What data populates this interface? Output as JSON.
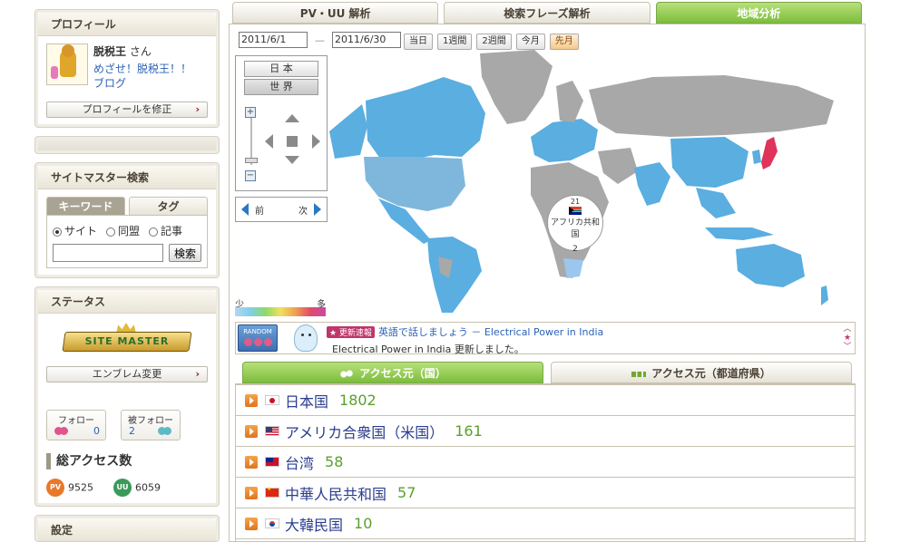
{
  "sidebar": {
    "profile": {
      "title": "プロフィール",
      "name": "脱税王",
      "suffix": " さん",
      "blog_line1": "めざせ！脱税王！！",
      "blog_line2": "ブログ",
      "edit_label": "プロフィールを修正"
    },
    "search": {
      "title": "サイトマスター検索",
      "tab_keyword": "キーワード",
      "tab_tag": "タグ",
      "radio_site": "サイト",
      "radio_alliance": "同盟",
      "radio_article": "記事",
      "button": "検索"
    },
    "status": {
      "title": "ステータス",
      "emblem_text": "SITE MASTER",
      "emblem_change": "エンブレム変更",
      "follow_label": "フォロー",
      "follow_count": "0",
      "followed_label": "被フォロー",
      "followed_count": "2",
      "total_title": "総アクセス数",
      "pv_badge": "PV",
      "pv_value": "9525",
      "uu_badge": "UU",
      "uu_value": "6059"
    },
    "settings": {
      "title": "設定"
    }
  },
  "main": {
    "tabs": [
      {
        "label": "PV・UU 解析"
      },
      {
        "label": "検索フレーズ解析"
      },
      {
        "label": "地域分析"
      }
    ],
    "date_from": "2011/6/1",
    "date_sep": "—",
    "date_to": "2011/6/30",
    "range_buttons": [
      {
        "label": "当日"
      },
      {
        "label": "1週間"
      },
      {
        "label": "2週間"
      },
      {
        "label": "今月"
      },
      {
        "label": "先月"
      }
    ],
    "map_ctrl": {
      "japan": "日 本",
      "world": "世 界",
      "zoom_plus": "+",
      "zoom_minus": "−",
      "prev": "前",
      "next": "次"
    },
    "legend": {
      "low": "少",
      "high": "多"
    },
    "callout": {
      "rank": "21",
      "country": "アフリカ共和国",
      "count": "2"
    },
    "ticker": {
      "random_label": "RANDOM",
      "badge": "★ 更新速報",
      "link": "英語で話しましょう － Electrical Power in India",
      "message": "Electrical Power in India  更新しました。"
    },
    "access_tabs": [
      {
        "label": "アクセス元（国）"
      },
      {
        "label": "アクセス元（都道府県）"
      }
    ],
    "countries": [
      {
        "name": "日本国",
        "count": "1802"
      },
      {
        "name": "アメリカ合衆国（米国）",
        "count": "161"
      },
      {
        "name": "台湾",
        "count": "58"
      },
      {
        "name": "中華人民共和国",
        "count": "57"
      },
      {
        "name": "大韓民国",
        "count": "10"
      }
    ]
  },
  "colors": {
    "accent_green": "#7cbd3c",
    "map_blue": "#5aaee0",
    "map_gray": "#a8a8a8",
    "japan_red": "#e0335a",
    "link_blue": "#2b62b5"
  }
}
